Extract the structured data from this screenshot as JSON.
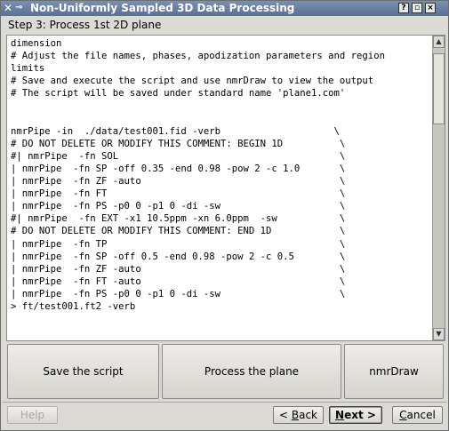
{
  "window": {
    "title": "Non-Uniformly Sampled 3D Data Processing",
    "help_glyph": "?",
    "minimize_glyph": "▫",
    "close_glyph": "×"
  },
  "step": {
    "title": "Step 3: Process 1st 2D plane"
  },
  "script_lines": [
    "dimension",
    "# Adjust the file names, phases, apodization parameters and region",
    "limits",
    "# Save and execute the script and use nmrDraw to view the output",
    "# The script will be saved under standard name 'plane1.com'",
    "",
    "",
    "nmrPipe -in  ./data/test001.fid -verb                    \\",
    "# DO NOT DELETE OR MODIFY THIS COMMENT: BEGIN 1D          \\",
    "#| nmrPipe  -fn SOL                                       \\",
    "| nmrPipe  -fn SP -off 0.35 -end 0.98 -pow 2 -c 1.0       \\",
    "| nmrPipe  -fn ZF -auto                                   \\",
    "| nmrPipe  -fn FT                                         \\",
    "| nmrPipe  -fn PS -p0 0 -p1 0 -di -sw                     \\",
    "#| nmrPipe  -fn EXT -x1 10.5ppm -xn 6.0ppm  -sw           \\",
    "# DO NOT DELETE OR MODIFY THIS COMMENT: END 1D            \\",
    "| nmrPipe  -fn TP                                         \\",
    "| nmrPipe  -fn SP -off 0.5 -end 0.98 -pow 2 -c 0.5        \\",
    "| nmrPipe  -fn ZF -auto                                   \\",
    "| nmrPipe  -fn FT -auto                                   \\",
    "| nmrPipe  -fn PS -p0 0 -p1 0 -di -sw                     \\",
    "> ft/test001.ft2 -verb"
  ],
  "actions": {
    "save_label": "Save the script",
    "process_label": "Process the plane",
    "nmrdraw_label": "nmrDraw"
  },
  "nav": {
    "help_label": "Help",
    "back_prefix": "< ",
    "back_mnemonic": "B",
    "back_rest": "ack",
    "next_mnemonic": "N",
    "next_rest": "ext >",
    "cancel_mnemonic": "C",
    "cancel_rest": "ancel"
  },
  "icons": {
    "close": "close-x-icon",
    "pin": "pin-icon",
    "help": "help-icon",
    "minimize": "minimize-icon",
    "window_close": "close-icon",
    "scroll_up": "arrow-up-icon",
    "scroll_down": "arrow-down-icon"
  },
  "colors": {
    "titlebar": "#5a6f95",
    "window_bg": "#dcdad5",
    "text_bg": "#ffffff"
  }
}
